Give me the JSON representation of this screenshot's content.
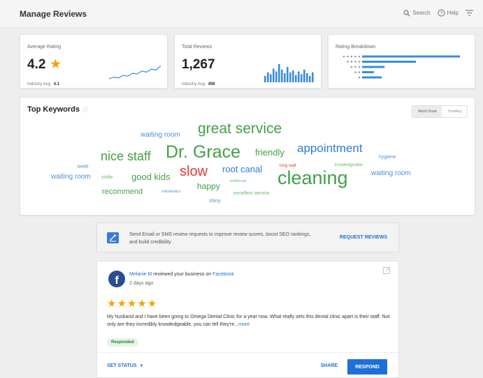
{
  "header": {
    "title": "Manage Reviews",
    "search_label": "Search",
    "help_label": "Help"
  },
  "stats": {
    "average_rating": {
      "label": "Average Rating",
      "value": "4.2",
      "industry_label": "Industry Avg.",
      "industry_value": "4.1",
      "trend": [
        0.2,
        0.28,
        0.24,
        0.38,
        0.34,
        0.5,
        0.46,
        0.62,
        0.56,
        0.72,
        0.68,
        0.9
      ]
    },
    "total_reviews": {
      "label": "Total Reviews",
      "value": "1,267",
      "industry_label": "Industry Avg.",
      "industry_value": "498",
      "bars": [
        0.35,
        0.55,
        0.45,
        0.75,
        0.6,
        1.0,
        0.7,
        0.5,
        0.85,
        0.55,
        0.65,
        0.4,
        0.6,
        0.45,
        0.7,
        0.5,
        0.35,
        0.55
      ]
    },
    "rating_breakdown": {
      "label": "Rating Breakdown",
      "rows": [
        {
          "stars": 5,
          "fraction": 1.0
        },
        {
          "stars": 4,
          "fraction": 0.55
        },
        {
          "stars": 3,
          "fraction": 0.23
        },
        {
          "stars": 2,
          "fraction": 0.12
        },
        {
          "stars": 1,
          "fraction": 0.2
        }
      ]
    }
  },
  "keywords": {
    "title": "Top Keywords",
    "toggle": [
      "Word Cloud",
      "Trending"
    ],
    "words": [
      {
        "text": "great service",
        "color": "#43a047"
      },
      {
        "text": "waiting room",
        "color": "#4a90d9"
      },
      {
        "text": "Dr. Grace",
        "color": "#43a047"
      },
      {
        "text": "nice staff",
        "color": "#43a047"
      },
      {
        "text": "friendly",
        "color": "#43a047"
      },
      {
        "text": "appointment",
        "color": "#2f7bd8"
      },
      {
        "text": "hygiene",
        "color": "#4a90d9"
      },
      {
        "text": "teeth",
        "color": "#4a90d9"
      },
      {
        "text": "slow",
        "color": "#e53935"
      },
      {
        "text": "root canal",
        "color": "#2f7bd8"
      },
      {
        "text": "long wait",
        "color": "#e53935"
      },
      {
        "text": "knowledgeable",
        "color": "#66bb6a"
      },
      {
        "text": "waiting room",
        "color": "#4a90d9"
      },
      {
        "text": "smile",
        "color": "#66bb6a"
      },
      {
        "text": "good kids",
        "color": "#43a047"
      },
      {
        "text": "cleaning",
        "color": "#43a047"
      },
      {
        "text": "waiting room",
        "color": "#4a90d9"
      },
      {
        "text": "happy",
        "color": "#43a047"
      },
      {
        "text": "toothbrush",
        "color": "#66bb6a"
      },
      {
        "text": "recommend",
        "color": "#43a047"
      },
      {
        "text": "orthodontics",
        "color": "#4a90d9"
      },
      {
        "text": "excellent service",
        "color": "#66bb6a"
      },
      {
        "text": "shiny",
        "color": "#4a90d9"
      }
    ]
  },
  "promo": {
    "text": "Send Email or SMS review requests to improve review scores, boost SEO rankings, and build credibility.",
    "button": "REQUEST REVIEWS"
  },
  "review": {
    "reviewer": "Melanie M",
    "action": " reviewed your business on ",
    "platform": "Facebook",
    "date": "2 days ago",
    "rating": "★★★★★",
    "text": "My husband and I have been going to Omega Dental Clinic for a year now. What really sets this dental clinic apart is their staff. Not only are they incredibly knowledgeable, you can tell they're...",
    "more": "more",
    "status_badge": "Responded",
    "set_status": "SET STATUS",
    "share": "SHARE",
    "respond": "RESPOND"
  },
  "colors": {
    "accent": "#1e6fd9",
    "star": "#f0a500",
    "positive": "#43a047",
    "negative": "#e53935"
  }
}
